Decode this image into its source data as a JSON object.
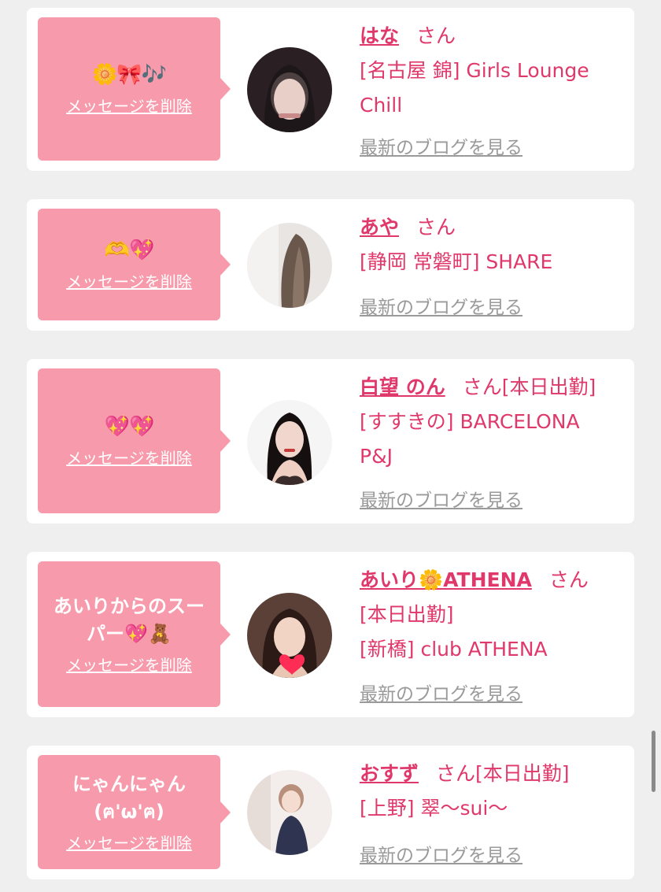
{
  "delete_label": "メッセージを削除",
  "blog_label": "最新のブログを見る",
  "honorific": "さん",
  "colors": {
    "bubble": "#f79aab",
    "accent": "#e0386b",
    "blog_link": "#9a9a9a",
    "background": "#efefef"
  },
  "items": [
    {
      "message": "🌼🎀🎶",
      "name": "はな",
      "status": "",
      "shop_lines": [
        "[名古屋 錦] Girls Lounge",
        "Chill"
      ]
    },
    {
      "message": "🫶💖",
      "name": "あや",
      "status": "",
      "shop_lines": [
        "[静岡 常磐町] SHARE"
      ]
    },
    {
      "message": "💖💖",
      "name": "白望 のん",
      "status": "[本日出勤]",
      "shop_lines": [
        "[すすきの] BARCELONA",
        "P&J"
      ]
    },
    {
      "message": "あいりからのスー\nパー💖🧸",
      "name": "あいり🌼ATHENA",
      "status": "",
      "shop_lines": [
        "[本日出勤]",
        "[新橋] club ATHENA"
      ]
    },
    {
      "message": "にゃんにゃん\n(ฅ'ω'ฅ)",
      "name": "おすず",
      "status": "[本日出勤]",
      "shop_lines": [
        "[上野] 翠〜sui〜"
      ]
    }
  ]
}
